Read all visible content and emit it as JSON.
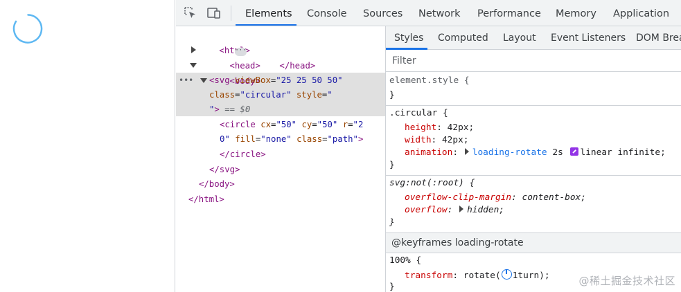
{
  "main_tabs": [
    "Elements",
    "Console",
    "Sources",
    "Network",
    "Performance",
    "Memory",
    "Application"
  ],
  "side_tabs": [
    "Styles",
    "Computed",
    "Layout",
    "Event Listeners",
    "DOM Brea"
  ],
  "filter": {
    "placeholder": "Filter"
  },
  "dom": {
    "html_open": "<html>",
    "head_open": "<head>",
    "head_close": "</head>",
    "body_open": "<body>",
    "svg_tag": "<svg",
    "svg_viewbox_attr": "viewBox",
    "svg_viewbox_val": "\"25 25 50 50\"",
    "svg_class_attr": "class",
    "svg_class_val": "\"circular\"",
    "svg_style_attr": "style",
    "svg_style_val_open": "\"",
    "svg_style_val_close": "\"",
    "svg_gt": ">",
    "selected_marker": "== $0",
    "circle_tag": "<circle",
    "circle_cx_attr": "cx",
    "circle_cx_val": "\"50\"",
    "circle_cy_attr": "cy",
    "circle_cy_val": "\"50\"",
    "circle_r_attr": "r",
    "circle_r_val_a": "\"2",
    "circle_r_val_b": "0\"",
    "circle_fill_attr": "fill",
    "circle_fill_val": "\"none\"",
    "circle_class_attr": "class",
    "circle_class_val": "\"path\"",
    "circle_gt": ">",
    "circle_close": "</circle>",
    "svg_close": "</svg>",
    "body_close": "</body>",
    "html_close": "</html>"
  },
  "styles": {
    "element_style": {
      "selector": "element.style {",
      "close": "}"
    },
    "circular": {
      "selector": ".circular {",
      "height_prop": "height",
      "height_val": "42px;",
      "width_prop": "width",
      "width_val": "42px;",
      "anim_prop": "animation",
      "anim_name": "loading-rotate",
      "anim_duration": "2s",
      "anim_rest": "linear infinite;",
      "close": "}"
    },
    "svg_not_root": {
      "selector": "svg:not(:root) {",
      "clip_prop": "overflow-clip-margin",
      "clip_val": "content-box;",
      "overflow_prop": "overflow",
      "overflow_val": "hidden;",
      "close": "}"
    },
    "keyframes": {
      "header": "@keyframes loading-rotate",
      "selector": "100% {",
      "transform_prop": "transform",
      "transform_fn": "rotate(",
      "transform_val": "1turn);",
      "close": "}"
    }
  },
  "watermark": "@稀土掘金技术社区",
  "colors": {
    "accent": "#1a73e8",
    "spinner": "#5eb8f2",
    "tag": "#881280",
    "attr": "#994500",
    "value": "#1a1aa6",
    "property": "#c80000"
  }
}
